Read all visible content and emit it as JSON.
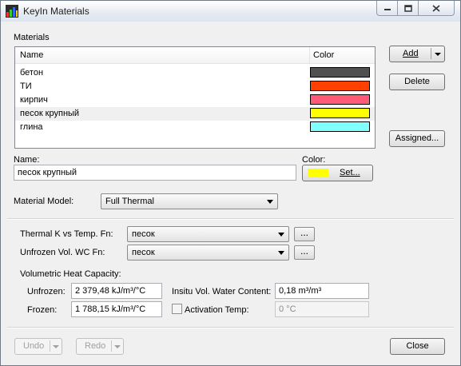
{
  "window": {
    "title": "KeyIn Materials"
  },
  "materials": {
    "group_label": "Materials",
    "columns": {
      "name": "Name",
      "color": "Color"
    },
    "rows": [
      {
        "name": "бетон",
        "color": "#505050"
      },
      {
        "name": "ТИ",
        "color": "#ff4000"
      },
      {
        "name": "кирпич",
        "color": "#ff5a78"
      },
      {
        "name": "песок крупный",
        "color": "#ffff00",
        "selected": true
      },
      {
        "name": "глина",
        "color": "#80ffff"
      }
    ]
  },
  "buttons": {
    "add": "Add",
    "delete": "Delete",
    "assigned": "Assigned...",
    "set": "Set...",
    "undo": "Undo",
    "redo": "Redo",
    "close": "Close",
    "ellipsis": "..."
  },
  "name_field": {
    "label": "Name:",
    "value": "песок крупный"
  },
  "color_field": {
    "label": "Color:",
    "swatch": "#ffff00"
  },
  "material_model": {
    "label": "Material Model:",
    "value": "Full Thermal"
  },
  "thermal_k": {
    "label": "Thermal K vs Temp. Fn:",
    "value": "песок"
  },
  "unfrozen_wc": {
    "label": "Unfrozen Vol. WC Fn:",
    "value": "песок"
  },
  "heat_capacity": {
    "label": "Volumetric Heat Capacity:",
    "unfrozen_label": "Unfrozen:",
    "unfrozen_value": "2 379,48 kJ/m³/°C",
    "frozen_label": "Frozen:",
    "frozen_value": "1 788,15 kJ/m³/°C"
  },
  "insitu": {
    "label": "Insitu Vol. Water Content:",
    "value": "0,18 m³/m³"
  },
  "activation": {
    "label": "Activation Temp:",
    "value": "0 °C",
    "checked": false
  }
}
